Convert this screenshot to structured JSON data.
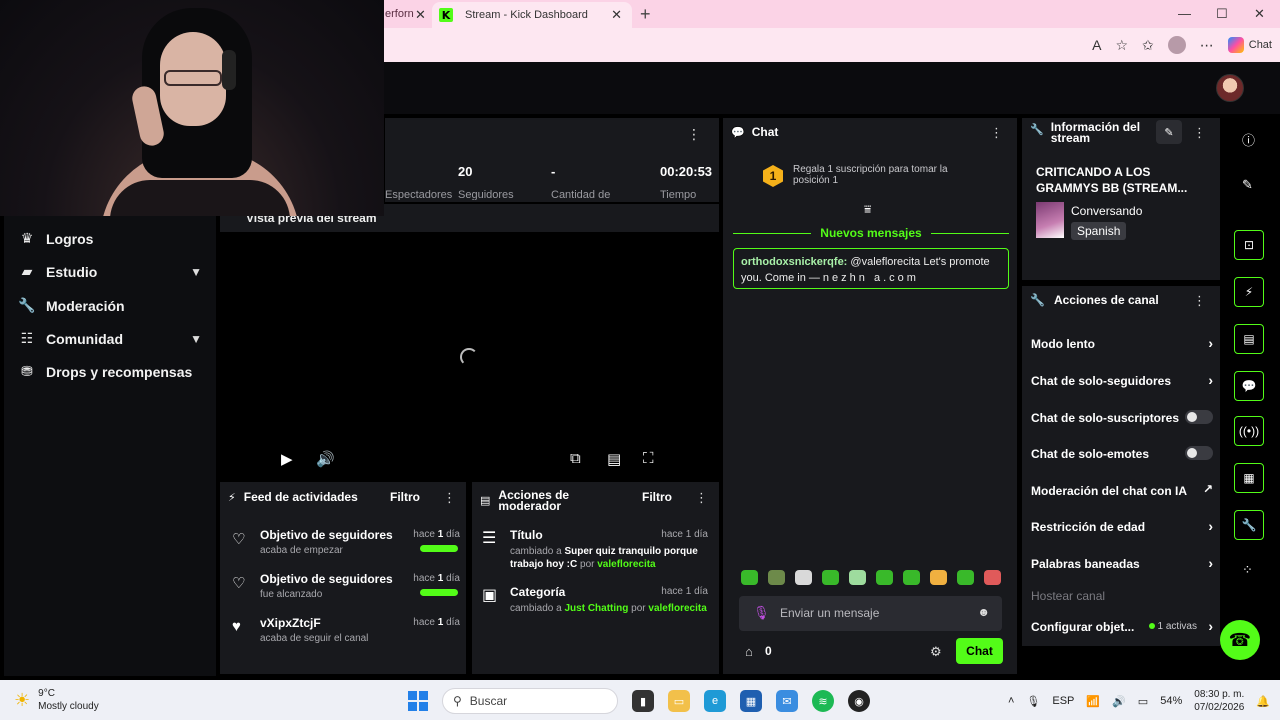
{
  "browser": {
    "prev_tab_label": "erforn",
    "active_tab_label": "Stream - Kick Dashboard",
    "copilot_label": "Chat"
  },
  "sidebar": {
    "items": [
      {
        "label": "Logros",
        "icon": "trophy-icon"
      },
      {
        "label": "Estudio",
        "icon": "studio-icon"
      },
      {
        "label": "Moderación",
        "icon": "wrench-icon"
      },
      {
        "label": "Comunidad",
        "icon": "community-icon"
      },
      {
        "label": "Drops y recompensas",
        "icon": "drops-icon"
      }
    ]
  },
  "stats": {
    "values": [
      "20",
      "-",
      "00:20:53"
    ],
    "labels": [
      "Espectadores",
      "Seguidores",
      "Cantidad de",
      "Tiempo"
    ]
  },
  "preview": {
    "title": "Vista previa del stream"
  },
  "activity_feed": {
    "title": "Feed de actividades",
    "filter": "Filtro",
    "items": [
      {
        "title": "Objetivo de seguidores",
        "sub": "acaba de empezar",
        "time_prefix": "hace ",
        "time_num": "1",
        "time_suffix": " día"
      },
      {
        "title": "Objetivo de seguidores",
        "sub": "fue alcanzado",
        "time_prefix": "hace ",
        "time_num": "1",
        "time_suffix": " día"
      },
      {
        "title": "vXipxZtcjF",
        "sub": "acaba de seguir el canal",
        "time_prefix": "hace ",
        "time_num": "1",
        "time_suffix": " día"
      }
    ]
  },
  "mod_actions": {
    "title": "Acciones de moderador",
    "filter": "Filtro",
    "items": [
      {
        "title": "Título",
        "time": "hace 1 día",
        "changed": "cambiado a ",
        "value": "Super quiz tranquilo porque trabajo hoy :C",
        "by": " por ",
        "user": "valeflorecita"
      },
      {
        "title": "Categoría",
        "time": "hace 1 día",
        "changed": "cambiado a ",
        "value": "Just Chatting",
        "by": " por ",
        "user": "valeflorecita"
      }
    ]
  },
  "chat": {
    "title": "Chat",
    "sub_promo": "Regala 1 suscripción para tomar la posición 1",
    "badge": "1",
    "new_messages": "Nuevos mensajes",
    "message_user": "orthodoxsnickerqfe:",
    "message_text": " @valeflorecita Let's promote you. Come in — ",
    "message_link": "nezhn a.com",
    "input_placeholder": "Enviar un mensaje",
    "count": "0",
    "send_label": "Chat"
  },
  "stream_info": {
    "title": "Información del stream",
    "stream_title": "CRITICANDO A LOS GRAMMYS BB (STREAM...",
    "category": "Conversando",
    "language": "Spanish"
  },
  "channel_actions": {
    "title": "Acciones de canal",
    "items": [
      {
        "label": "Modo lento",
        "control": "chevron"
      },
      {
        "label": "Chat de solo-seguidores",
        "control": "chevron"
      },
      {
        "label": "Chat de solo-suscriptores",
        "control": "toggle"
      },
      {
        "label": "Chat de solo-emotes",
        "control": "toggle"
      },
      {
        "label": "Moderación del chat con IA",
        "control": "external"
      },
      {
        "label": "Restricción de edad",
        "control": "chevron"
      },
      {
        "label": "Palabras baneadas",
        "control": "chevron"
      }
    ],
    "host_label": "Hostear canal",
    "config_label": "Configurar objet...",
    "config_status": "1 activas"
  },
  "taskbar": {
    "temp": "9°C",
    "weather": "Mostly cloudy",
    "search_placeholder": "Buscar",
    "lang": "ESP",
    "battery": "54%",
    "time": "08:30 p. m.",
    "date": "07/02/2026"
  },
  "colors": {
    "accent": "#53fc18",
    "panel": "#18191d",
    "background": "#000000"
  }
}
